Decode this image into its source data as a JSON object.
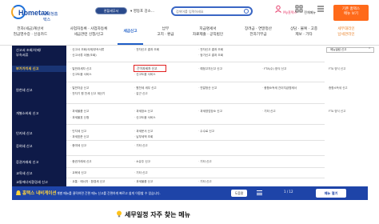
{
  "header": {
    "logo_main": "Hometax",
    "logo_sub": "국세청홈택스",
    "tax_office_btn": "관할세무서",
    "office_select": "▾  영등포 강소...",
    "search_placeholder": "검색어를 입력하세요",
    "my_hometax": "My홈택스",
    "all_menu": "전체메뉴",
    "login_btn_line1": "기존 홈택스",
    "login_btn_line2": "메뉴 보기"
  },
  "nav": {
    "items": [
      {
        "line1": "전자(세금)계산서",
        "line2": "현금영수증 · 신용카드"
      },
      {
        "line1": "사업자등록 · 사업자등록",
        "line2": "세금관련 신청/신고"
      },
      {
        "line1": "세금신고",
        "line2": ""
      },
      {
        "line1": "납부",
        "line2": "고지 · 환급"
      },
      {
        "line1": "지급명세서",
        "line2": "자료제출 · 공익법인"
      },
      {
        "line1": "장려금 · 연말정산",
        "line2": "전자기부금"
      },
      {
        "line1": "상담 · 불복 · 고충",
        "line2": "제보 · 기타"
      },
      {
        "line1": "세무대리인",
        "line2": "납세관리인"
      }
    ]
  },
  "left_menu": [
    "신고서 조회/삭제/",
    "부속서류",
    "부가가치세 신고",
    "원천세 신고",
    "개별소비세 신고",
    "인지세 신고",
    "증여세 신고",
    "증권거래세 신고",
    "교육세 신고",
    "교통에너지환경세 신고"
  ],
  "content": {
    "rows": [
      [
        "신고서 조회/삭제/부속서류",
        "전자신고 결과 조회",
        "전자신고 결과 조회"
      ],
      [
        "신고서류 이용(조회)",
        "정기신고 결과 조회",
        ""
      ],
      [
        "일반과세자 신고",
        "간이과세자 신고",
        "예정고지신고 신고",
        "FTA(수) 양식 신고"
      ],
      [
        "신고도움 서비스",
        "신고도움 서비스"
      ],
      [
        "일반자금 신고",
        "원천세 세무 신고",
        "연말정산 신고",
        "종합소득세 간이지급명세서"
      ],
      [
        "전자기 원 천세 신고 계산기",
        "갑근 신고"
      ],
      [
        "과세물품 신고",
        "과세장소 신고",
        "과세영업장소 신고",
        "기타 신고"
      ],
      [
        "과세율표 신청",
        "신고도움 서비스"
      ],
      [
        "인지세 신고",
        "과세문서 신고",
        "수수료 신고"
      ],
      [
        "과세표준 신고",
        "납부세액 조회",
        "납부세액 신고"
      ],
      [
        "증여세 신고",
        "기타 신고"
      ],
      [
        "증권거래세 신고",
        "소유주 신고",
        "기타 신고"
      ],
      [
        "교육세 신고",
        "기타 신고"
      ],
      [
        "교통 · 에너지 · 환경세 신고",
        "과세물품 신고",
        "기타 신고"
      ]
    ],
    "highlight": "간이과세자 신고"
  },
  "right_panel": {
    "title": "메뉴빌림 신고",
    "items": [
      "FTA 양식 신고",
      "종합소득세 신고",
      "FTA 양식 신고"
    ]
  },
  "banner": {
    "brand": "홈택스 내비게이션",
    "message": "개별 메뉴를 클릭하면 간편 메뉴 신고를 간편하게 빠르고 쉽게 이용할 수 있습니다.",
    "help": "도움말",
    "pager": "1 / 12",
    "open_btn": "메뉴 열기"
  },
  "faq": {
    "title": "세무일정 자주 찾는 메뉴"
  },
  "colors": {
    "brand_blue": "#1d4fa8",
    "nav_active": "#1e5ec7",
    "left_panel_bg": "#0e1a48",
    "banner_bg": "#1e44a8",
    "login_btn": "#ff6a1a",
    "highlight_red": "#e02020"
  }
}
